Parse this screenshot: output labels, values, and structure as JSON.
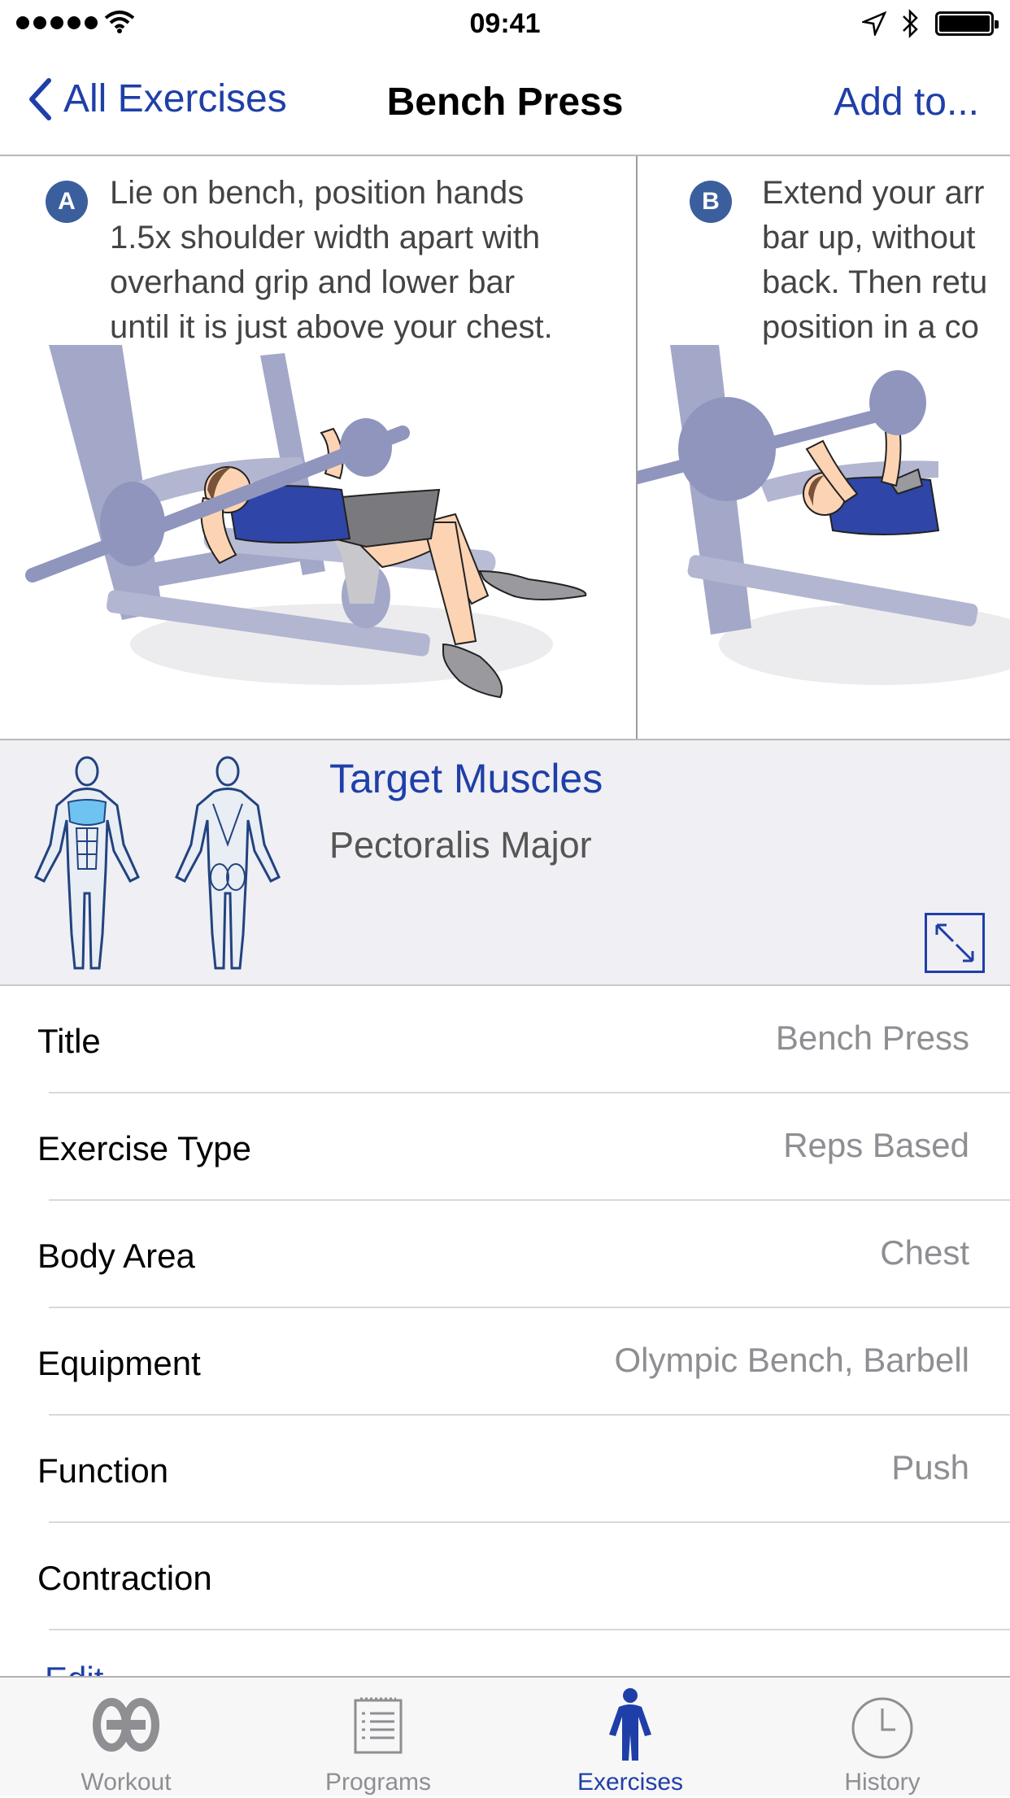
{
  "status_bar": {
    "time": "09:41"
  },
  "nav": {
    "back_label": "All Exercises",
    "title": "Bench Press",
    "action_label": "Add to..."
  },
  "steps": [
    {
      "badge": "A",
      "lines": [
        "Lie on bench, position hands",
        "1.5x shoulder width apart with",
        "overhand grip and lower bar",
        "until it is just above your chest."
      ]
    },
    {
      "badge": "B",
      "lines": [
        "Extend your arr",
        "bar up, without",
        "back. Then retu",
        "position in a co"
      ]
    }
  ],
  "target": {
    "title": "Target Muscles",
    "value": "Pectoralis Major"
  },
  "details": [
    {
      "label": "Title",
      "value": "Bench Press"
    },
    {
      "label": "Exercise Type",
      "value": "Reps Based"
    },
    {
      "label": "Body Area",
      "value": "Chest"
    },
    {
      "label": "Equipment",
      "value": "Olympic Bench, Barbell"
    },
    {
      "label": "Function",
      "value": "Push"
    },
    {
      "label": "Contraction",
      "value": ""
    }
  ],
  "edit_label": "Edit",
  "tabs": [
    {
      "label": "Workout",
      "icon": "workout-icon"
    },
    {
      "label": "Programs",
      "icon": "programs-icon"
    },
    {
      "label": "Exercises",
      "icon": "exercises-icon",
      "active": true
    },
    {
      "label": "History",
      "icon": "history-icon"
    }
  ],
  "colors": {
    "accent": "#1f3fa8",
    "step_badge": "#3b5f9d",
    "muscle_highlight": "#6fc3f0",
    "equipment": "#a3a8c8"
  }
}
